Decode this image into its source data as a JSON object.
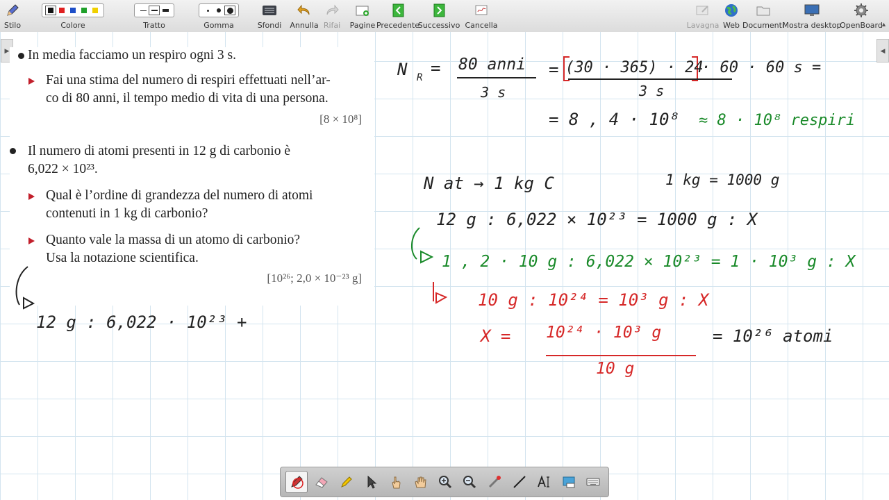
{
  "toolbar": {
    "stilo": "Stilo",
    "colore": "Colore",
    "tratto": "Tratto",
    "gomma": "Gomma",
    "sfondi": "Sfondi",
    "annulla": "Annulla",
    "rifai": "Rifai",
    "pagine": "Pagine",
    "precedente": "Precedente",
    "successivo": "Successivo",
    "cancella": "Cancella",
    "lavagna": "Lavagna",
    "web": "Web",
    "documenti": "Documenti",
    "mostra_desktop": "Mostra desktop",
    "openboard": "OpenBoard",
    "colors": [
      "#111111",
      "#e02020",
      "#1e4fc8",
      "#1fa02a",
      "#f0d000"
    ]
  },
  "doc": {
    "p1": "In media facciamo un respiro ogni 3 s.",
    "p1_q1_line1": "Fai una stima del numero di respiri effettuati nell’ar-",
    "p1_q1_line2": "co di 80 anni, il tempo medio di vita di una persona.",
    "p1_answer": "[8 × 10⁸]",
    "p2_line1": "Il numero di atomi presenti in 12 g di carbonio è",
    "p2_line2": "6,022 × 10²³.",
    "p2_q1_line1": "Qual è l’ordine di grandezza del numero di atomi",
    "p2_q1_line2": "contenuti in 1 kg di carbonio?",
    "p2_q2_line1": "Quanto vale la massa di un atomo di carbonio?",
    "p2_q2_line2": "Usa la notazione scientifica.",
    "p2_answer": "[10²⁶; 2,0 × 10⁻²³ g]"
  },
  "ink": {
    "left_eq": "12 g : 6,022 · 10²³ +",
    "l1_lhs": "N",
    "l1_sub": "R",
    "l1_eq": "=",
    "l1_num": "80 anni",
    "l1_den": "3 s",
    "l1_eq2": "=",
    "l1_num2": "(30 · 365) · 24",
    "l1_rest": "· 60 · 60 s =",
    "l1_den2": "3 s",
    "l2": "= 8 , 4 · 10⁸",
    "l2_green": "≈ 8 · 10⁸ respiri",
    "l3": "N at → 1 kg C",
    "l3b": "1 kg = 1000 g",
    "l4": "12 g : 6,022 × 10²³ = 1000 g : X",
    "l5_green": "1 , 2 · 10 g : 6,022 × 10²³ = 1 · 10³ g : X",
    "l6_red": "10 g : 10²⁴ = 10³ g : X",
    "l7_x": "X =",
    "l7_num": "10²⁴ · 10³ g",
    "l7_den": "10 g",
    "l7_res": "= 10²⁶ atomi"
  }
}
